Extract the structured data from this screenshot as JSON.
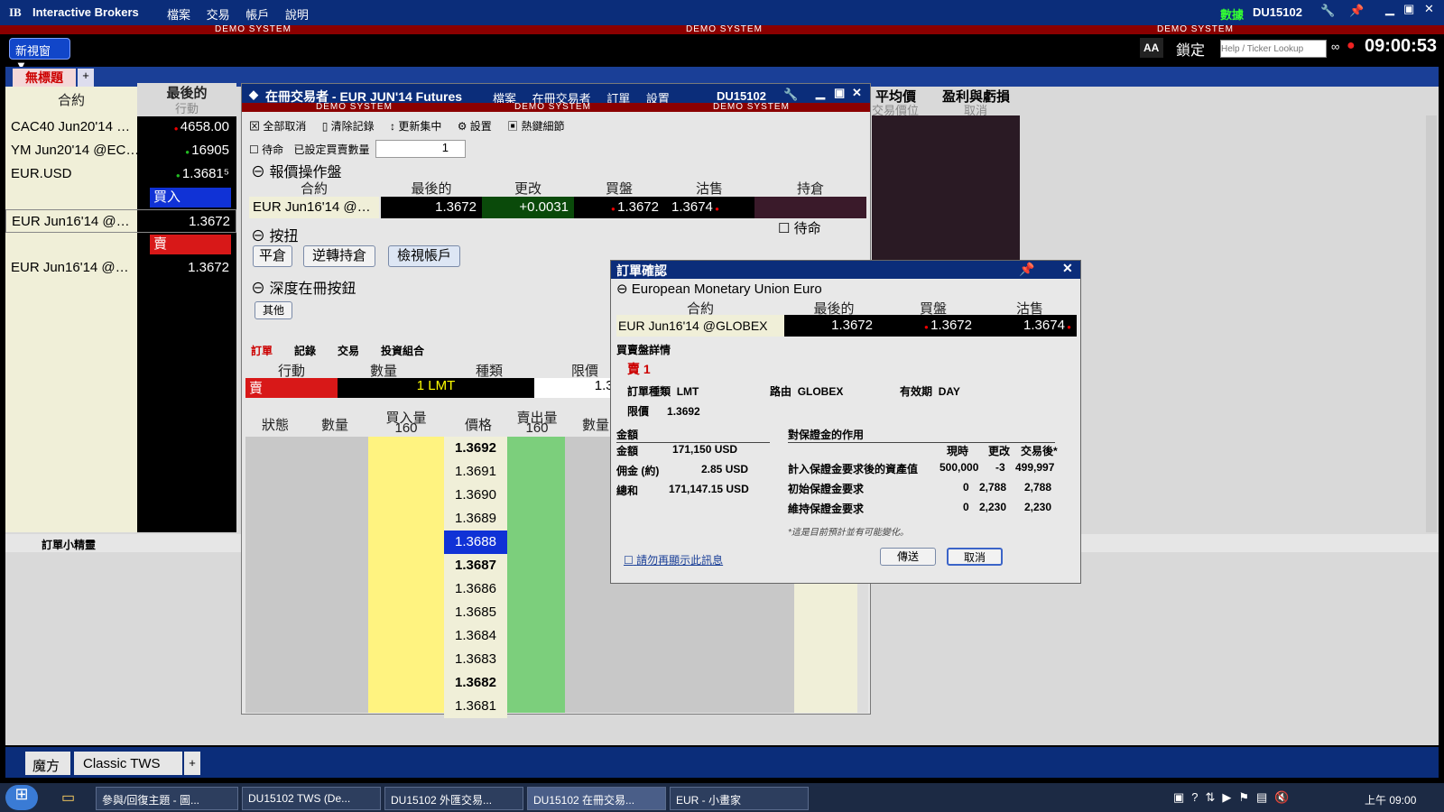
{
  "app": {
    "logo": "IB",
    "title": "Interactive Brokers",
    "menu": [
      "檔案",
      "交易",
      "帳戶",
      "說明"
    ],
    "demo": "DEMO SYSTEM",
    "data_label": "數據",
    "account": "DU15102",
    "clock": "09:00:53",
    "help_placeholder": "Help / Ticker Lookup",
    "aa": "AA",
    "lock_label": "鎖定"
  },
  "new_window": "新視窗 ▼",
  "tab": {
    "name": "無標題"
  },
  "watchlist": {
    "col_contract": "合約",
    "col_last": "最後的",
    "col_action": "行動",
    "rows": [
      {
        "contract": "CAC40 Jun20'14 …",
        "last": "4658.00"
      },
      {
        "contract": "YM Jun20'14 @EC…",
        "last": "16905"
      },
      {
        "contract": "EUR.USD",
        "last": "1.3681⁵"
      },
      {
        "contract": "",
        "last": "買入"
      },
      {
        "contract": "EUR Jun16'14 @…",
        "last": "1.3672"
      },
      {
        "contract": "",
        "last": "賣"
      },
      {
        "contract": "EUR Jun16'14 @…",
        "last": "1.3672"
      }
    ]
  },
  "bg_cols": {
    "avg": "平均價",
    "avg_sub": "交易價位",
    "pnl": "盈利與虧損",
    "pnl_sub": "取消"
  },
  "order_wizard": "訂單小精靈",
  "booktrader": {
    "title": "在冊交易者 - EUR JUN'14 Futures",
    "menu": [
      "檔案",
      "在冊交易者",
      "訂單",
      "設置"
    ],
    "account": "DU15102",
    "demo": "DEMO SYSTEM",
    "toolbar": [
      "全部取消",
      "清除記錄",
      "更新集中",
      "設置",
      "熱鍵細節"
    ],
    "standby": "待命",
    "set_qty": "已設定買賣數量",
    "qty": "1",
    "quote_panel": "報價操作盤",
    "quote_cols": [
      "合約",
      "最後的",
      "更改",
      "買盤",
      "沽售",
      "持倉"
    ],
    "quote": {
      "contract": "EUR Jun16'14 @…",
      "last": "1.3672",
      "change": "+0.0031",
      "bid": "1.3672",
      "ask": "1.3674"
    },
    "buttons_panel": "按扭",
    "standby2": "待命",
    "buttons": [
      "平倉",
      "逆轉持倉",
      "檢視帳戶"
    ],
    "depth_panel": "深度在冊按鈕",
    "other": "其他",
    "tabs": [
      "訂單",
      "記錄",
      "交易",
      "投資組合"
    ],
    "order_cols": [
      "行動",
      "數量",
      "種類",
      "限價"
    ],
    "order": {
      "action": "賣",
      "qty": "1 LMT",
      "limit": "1.36"
    },
    "ladder_cols": [
      "狀態",
      "數量",
      "買入量",
      "價格",
      "賣出量",
      "數量"
    ],
    "buy_vol": "160",
    "sell_vol": "160",
    "prices": [
      "1.3692",
      "1.3691",
      "1.3690",
      "1.3689",
      "1.3688",
      "1.3687",
      "1.3686",
      "1.3685",
      "1.3684",
      "1.3683",
      "1.3682",
      "1.3681"
    ]
  },
  "dialog": {
    "title": "訂單確認",
    "instrument": "European Monetary Union Euro",
    "cols": [
      "合約",
      "最後的",
      "買盤",
      "沽售"
    ],
    "row": {
      "contract": "EUR Jun16'14 @GLOBEX",
      "last": "1.3672",
      "bid": "1.3672",
      "ask": "1.3674"
    },
    "details_hdr": "買賣盤詳情",
    "side": "賣 1",
    "type_l": "訂單種類",
    "type_v": "LMT",
    "route_l": "路由",
    "route_v": "GLOBEX",
    "tif_l": "有效期",
    "tif_v": "DAY",
    "limit_l": "限價",
    "limit_v": "1.3692",
    "amt_hdr": "金額",
    "amt_l": "金額",
    "amt_v": "171,150 USD",
    "comm_l": "佣金 (約)",
    "comm_v": "2.85 USD",
    "total_l": "總和",
    "total_v": "171,147.15 USD",
    "margin_hdr": "對保證金的作用",
    "m_cols": [
      "現時",
      "更改",
      "交易後*"
    ],
    "m_rows": [
      [
        "計入保證金要求後的資產值",
        "500,000",
        "-3",
        "499,997"
      ],
      [
        "初始保證金要求",
        "0",
        "2,788",
        "2,788"
      ],
      [
        "維持保證金要求",
        "0",
        "2,230",
        "2,230"
      ]
    ],
    "note": "*這是目前預計並有可能變化。",
    "no_show": "請勿再顯示此訊息",
    "transmit": "傳送",
    "cancel": "取消"
  },
  "bottom_tabs": [
    "魔方",
    "Classic TWS"
  ],
  "taskbar": {
    "items": [
      "參與/回復主題 - 圖...",
      "DU15102 TWS (De...",
      "DU15102 外匯交易...",
      "DU15102 在冊交易...",
      "EUR - 小畫家"
    ],
    "time": "上午 09:00"
  }
}
